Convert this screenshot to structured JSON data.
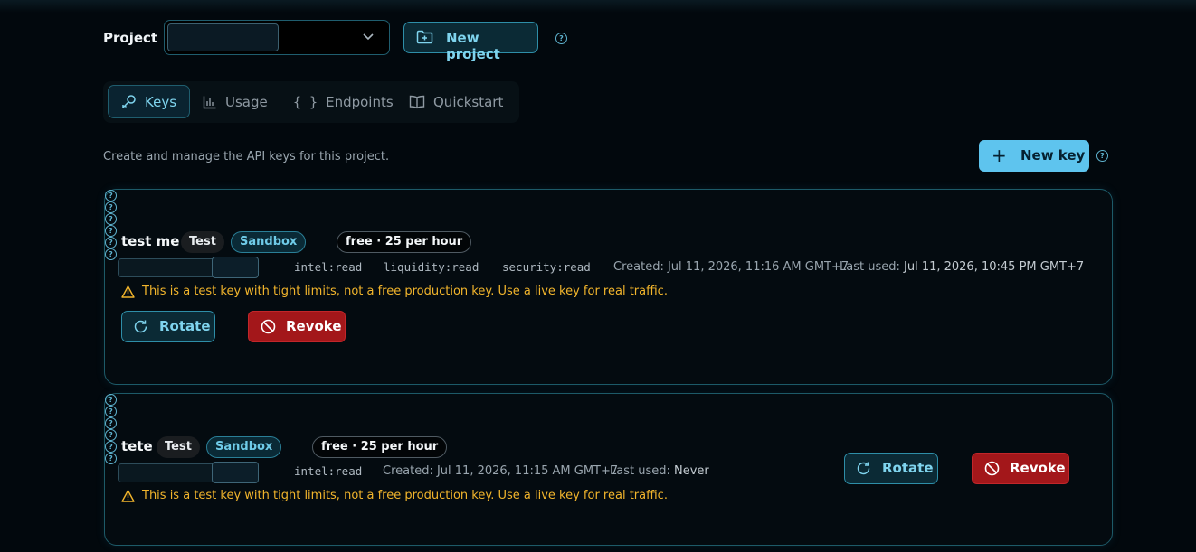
{
  "project": {
    "label": "Project",
    "selected_value": "",
    "new_project_label": "New project"
  },
  "tabs": [
    {
      "label": "Keys",
      "icon": "key-icon",
      "active": true
    },
    {
      "label": "Usage",
      "icon": "bar-chart-icon",
      "active": false
    },
    {
      "label": "Endpoints",
      "icon": "braces-icon",
      "active": false
    },
    {
      "label": "Quickstart",
      "icon": "book-icon",
      "active": false
    }
  ],
  "keys_section": {
    "description": "Create and manage the API keys for this project.",
    "new_key_label": "New key"
  },
  "keys": [
    {
      "name": "test me",
      "env_badge": "Test",
      "mode_badge": "Sandbox",
      "plan_badge": "free · 25 per hour",
      "key_value": "",
      "scopes": [
        "intel:read",
        "liquidity:read",
        "security:read"
      ],
      "created": "Created: Jul 11, 2026, 11:16 AM GMT+7",
      "last_used_label": "Last used:",
      "last_used_value": "Jul 11, 2026, 10:45 PM GMT+7",
      "warning": "This is a test key with tight limits, not a free production key. Use a live key for real traffic.",
      "rotate_label": "Rotate",
      "revoke_label": "Revoke"
    },
    {
      "name": "tete",
      "env_badge": "Test",
      "mode_badge": "Sandbox",
      "plan_badge": "free · 25 per hour",
      "key_value": "",
      "scopes": [
        "intel:read"
      ],
      "created": "Created: Jul 11, 2026, 11:15 AM GMT+7",
      "last_used_label": "Last used:",
      "last_used_value": "Never",
      "warning": "This is a test key with tight limits, not a free production key. Use a live key for real traffic.",
      "rotate_label": "Rotate",
      "revoke_label": "Revoke"
    }
  ],
  "colors": {
    "background": "#02080d",
    "accent": "#5ec4ee",
    "danger": "#a3171a",
    "warning": "#f2b52c"
  }
}
